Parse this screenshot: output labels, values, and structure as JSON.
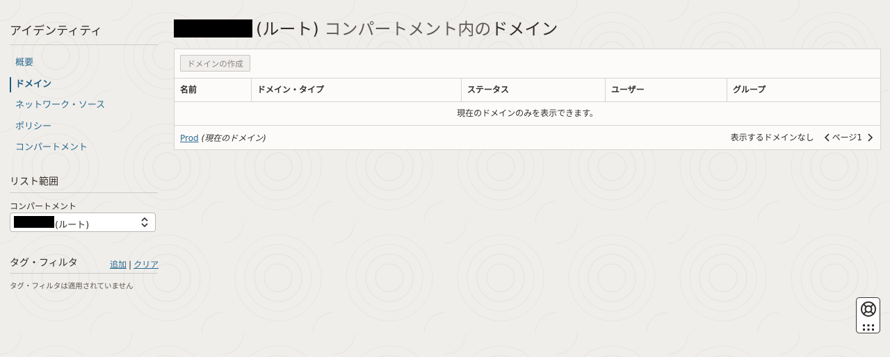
{
  "sidebar": {
    "title": "アイデンティティ",
    "nav": [
      {
        "label": "概要",
        "active": false
      },
      {
        "label": "ドメイン",
        "active": true
      },
      {
        "label": "ネットワーク・ソース",
        "active": false
      },
      {
        "label": "ポリシー",
        "active": false
      },
      {
        "label": "コンパートメント",
        "active": false
      }
    ],
    "list_scope_title": "リスト範囲",
    "compartment_label": "コンパートメント",
    "compartment_value": "(ルート)",
    "tag_filter_title": "タグ・フィルタ",
    "tag_add": "追加",
    "tag_separator": "|",
    "tag_clear": "クリア",
    "tag_note": "タグ・フィルタは適用されていません"
  },
  "header": {
    "title_root": "(ルート)",
    "title_middle": " コンパートメント内の",
    "title_end": "ドメイン"
  },
  "table": {
    "create_button": "ドメインの作成",
    "columns": [
      "名前",
      "ドメイン・タイプ",
      "ステータス",
      "ユーザー",
      "グループ"
    ],
    "empty_message": "現在のドメインのみを表示できます。",
    "footer_link": "Prod",
    "footer_link_note": "(現在のドメイン)",
    "no_domains_text": "表示するドメインなし",
    "page_label": "ページ1"
  },
  "colors": {
    "link": "#2b6a8f",
    "text": "#312d2a",
    "background": "#f0eeeb"
  },
  "icons": {
    "select_arrow": "chevron-up-down-icon",
    "prev_page": "chevron-left-icon",
    "next_page": "chevron-right-icon",
    "help": "lifebuoy-icon",
    "apps": "grid-icon"
  }
}
